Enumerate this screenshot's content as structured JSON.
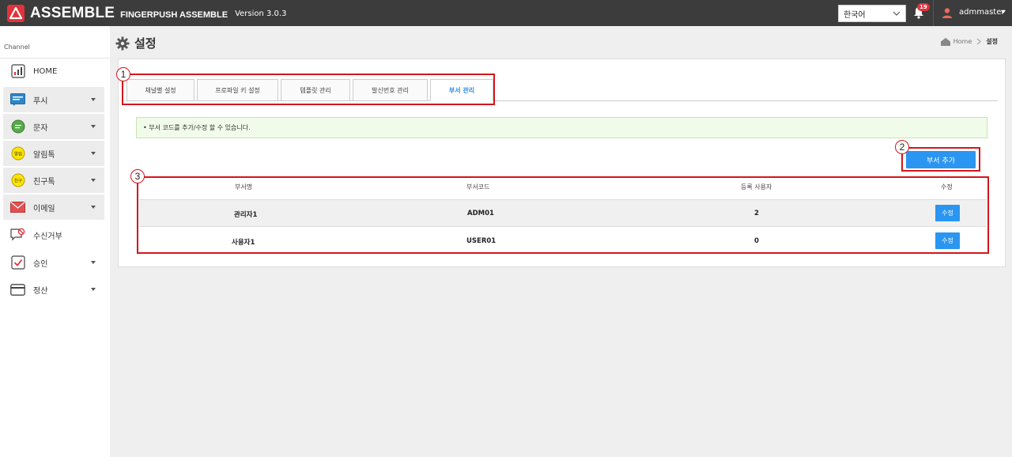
{
  "header": {
    "brand": "ASSEMBLE",
    "brand_sub": "FINGERPUSH ASSEMBLE",
    "version": "Version 3.0.3",
    "language": "한국어",
    "notification_count": "19",
    "username": "admmaster"
  },
  "sidebar": {
    "channel_label": "Channel",
    "items": [
      {
        "label": "HOME",
        "icon": "chart-icon"
      },
      {
        "label": "푸시",
        "icon": "push-icon"
      },
      {
        "label": "문자",
        "icon": "sms-icon"
      },
      {
        "label": "알림톡",
        "icon": "alimtalk-icon",
        "badge": "알림"
      },
      {
        "label": "친구톡",
        "icon": "friendtalk-icon",
        "badge": "친구"
      },
      {
        "label": "이메일",
        "icon": "mail-icon"
      },
      {
        "label": "수신거부",
        "icon": "reject-icon"
      },
      {
        "label": "승인",
        "icon": "check-icon"
      },
      {
        "label": "정산",
        "icon": "card-icon"
      }
    ]
  },
  "page": {
    "title": "설정",
    "breadcrumb_home": "Home",
    "breadcrumb_current": "설정"
  },
  "tabs": [
    {
      "label": "채널별 설정"
    },
    {
      "label": "프로파일 키 설정"
    },
    {
      "label": "템플릿 관리"
    },
    {
      "label": "발신번호 관리"
    },
    {
      "label": "부서 관리"
    }
  ],
  "info_text": "• 부서 코드를 추가/수정 할 수 있습니다.",
  "add_button": "부서 추가",
  "table": {
    "headers": [
      "부서명",
      "부서코드",
      "등록 사용자",
      "수정"
    ],
    "rows": [
      {
        "name": "관리자1",
        "code": "ADM01",
        "users": "2",
        "edit": "수정"
      },
      {
        "name": "사용자1",
        "code": "USER01",
        "users": "0",
        "edit": "수정"
      }
    ]
  },
  "callouts": [
    "1",
    "2",
    "3"
  ],
  "colors": {
    "topbar": "#3c3c3c",
    "accent": "#2a96f1",
    "callout": "#d4151b",
    "logo": "#e2323a"
  }
}
